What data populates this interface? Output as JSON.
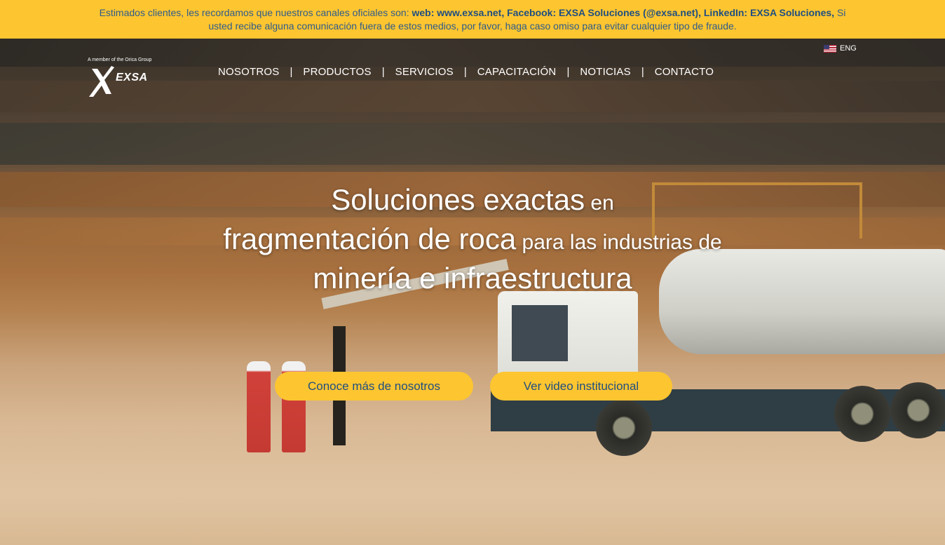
{
  "notice": {
    "line1_prefix": "Estimados clientes, les recordamos que nuestros canales oficiales son: ",
    "line1_channels": "web: www.exsa.net, Facebook: EXSA Soluciones (@exsa.net), LinkedIn: EXSA Soluciones,",
    "line1_suffix": " Si",
    "line2": "usted recibe alguna comunicación fuera de estos medios, por favor, haga caso omiso para evitar cualquier tipo de fraude."
  },
  "logo": {
    "tagline": "A member of the Orica Group",
    "word": "EXSA"
  },
  "lang": {
    "label": "ENG",
    "flag": "us-flag"
  },
  "nav": {
    "items": [
      "NOSOTROS",
      "PRODUCTOS",
      "SERVICIOS",
      "CAPACITACIÓN",
      "NOTICIAS",
      "CONTACTO"
    ],
    "separator": "|"
  },
  "headline": {
    "p1_big": "Soluciones exactas",
    "p1_small": " en",
    "p2_big": "fragmentación de roca",
    "p2_small": " para las industrias de",
    "p3_big": "minería e infraestructura"
  },
  "buttons": {
    "about": "Conoce más de nosotros",
    "video": "Ver video institucional"
  },
  "colors": {
    "accent": "#fdc530",
    "link": "#1f4f80"
  }
}
